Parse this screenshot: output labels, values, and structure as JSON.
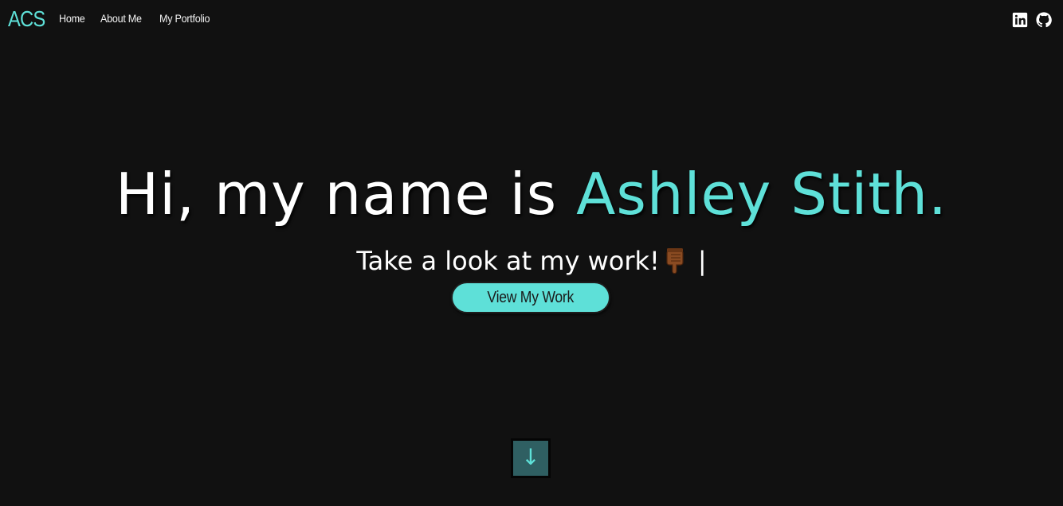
{
  "nav": {
    "brand": "ACS",
    "links": [
      {
        "label": "Home"
      },
      {
        "label": "About Me"
      },
      {
        "label": "My Portfolio"
      }
    ],
    "social": [
      {
        "icon": "linkedin-icon"
      },
      {
        "icon": "github-icon"
      }
    ]
  },
  "hero": {
    "title_prefix": "Hi, my name is ",
    "title_name": "Ashley Stith.",
    "subtitle": "Take a look at my work!",
    "subtitle_emoji": "pointing-down-hand-icon",
    "cursor": "|",
    "cta_label": "View My Work"
  },
  "scroll": {
    "arrow": "↓",
    "icon": "arrow-down-icon"
  },
  "colors": {
    "background": "#111111",
    "accent": "#5ee0d8",
    "scroll_button_bg": "#2f5f62",
    "text": "#ffffff"
  }
}
